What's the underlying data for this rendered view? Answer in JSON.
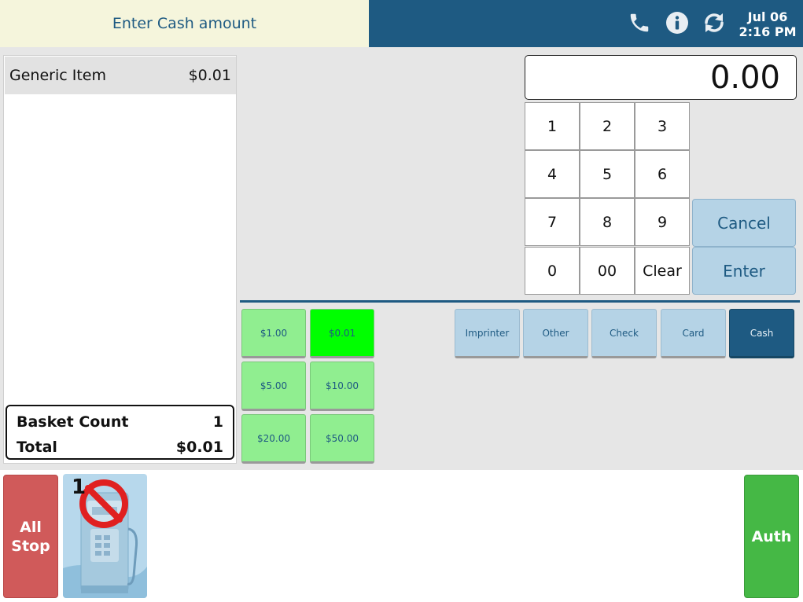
{
  "header": {
    "prompt": "Enter Cash amount",
    "date": "Jul 06",
    "time": "2:16 PM",
    "icons": [
      "phone-icon",
      "info-icon",
      "sync-icon"
    ]
  },
  "receipt": {
    "items": [
      {
        "name": "Generic Item",
        "price": "$0.01"
      }
    ],
    "basket_count_label": "Basket Count",
    "basket_count": "1",
    "total_label": "Total",
    "total": "$0.01"
  },
  "display": {
    "amount": "0.00"
  },
  "keypad": {
    "keys": [
      "1",
      "2",
      "3",
      "4",
      "5",
      "6",
      "7",
      "8",
      "9",
      "0",
      "00",
      "Clear"
    ],
    "cancel": "Cancel",
    "enter": "Enter"
  },
  "quick_cash": {
    "buttons": [
      "$1.00",
      "$0.01",
      "$5.00",
      "$10.00",
      "$20.00",
      "$50.00"
    ],
    "selected": "$0.01"
  },
  "tenders": {
    "buttons": [
      "Imprinter",
      "Other",
      "Check",
      "Card",
      "Cash"
    ],
    "active": "Cash"
  },
  "bottom": {
    "all_stop": "All Stop",
    "pump_number": "1",
    "auth": "Auth"
  },
  "colors": {
    "brand": "#1e5a82",
    "prompt_bg": "#f5f5dc",
    "quick_cash": "#90ee90",
    "quick_cash_selected": "#00ff00",
    "tender": "#b5d3e6",
    "all_stop": "#d05a5a",
    "auth": "#45b845"
  }
}
